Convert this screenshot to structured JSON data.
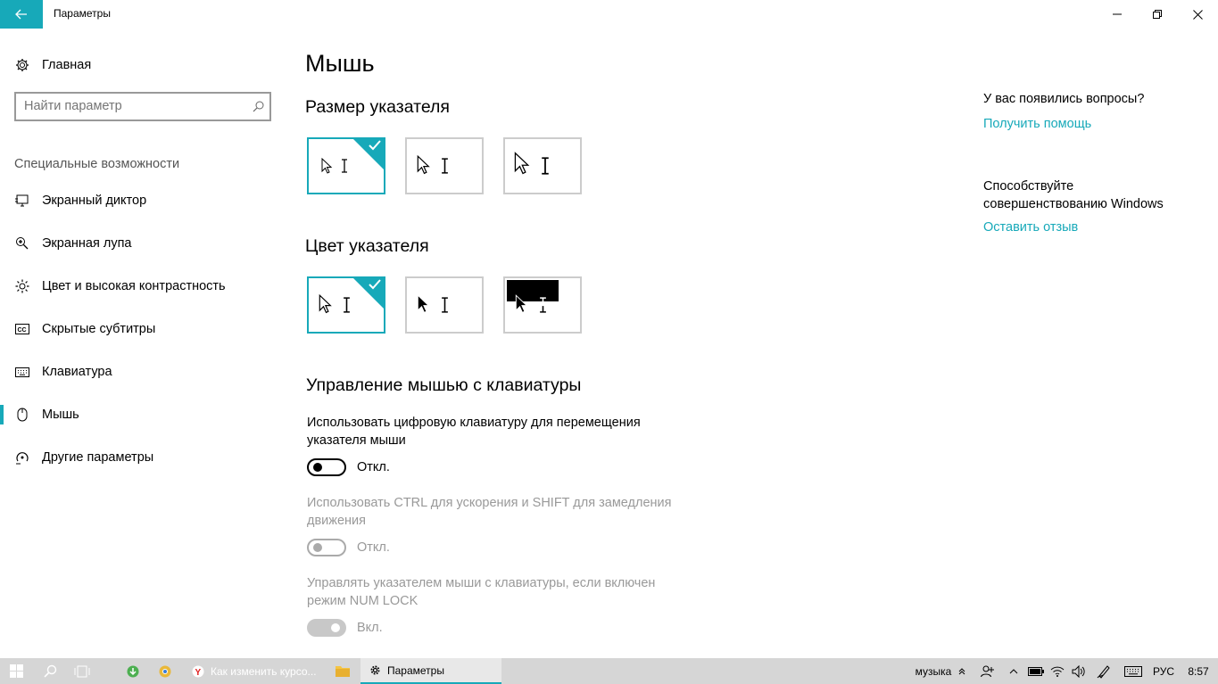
{
  "window": {
    "title": "Параметры",
    "icons": {
      "back": "back-arrow-icon",
      "minimize": "minimize-icon",
      "maximize": "restore-icon",
      "close": "close-icon"
    }
  },
  "sidebar": {
    "home_label": "Главная",
    "search_placeholder": "Найти параметр",
    "section_header": "Специальные возможности",
    "items": [
      {
        "label": "Экранный диктор",
        "icon": "narrator-icon"
      },
      {
        "label": "Экранная лупа",
        "icon": "magnifier-icon"
      },
      {
        "label": "Цвет и высокая контрастность",
        "icon": "brightness-icon"
      },
      {
        "label": "Скрытые субтитры",
        "icon": "closed-captions-icon"
      },
      {
        "label": "Клавиатура",
        "icon": "keyboard-icon"
      },
      {
        "label": "Мышь",
        "icon": "mouse-icon",
        "selected": true
      },
      {
        "label": "Другие параметры",
        "icon": "other-options-icon"
      }
    ]
  },
  "main": {
    "title": "Мышь",
    "pointer_size": {
      "heading": "Размер указателя",
      "selected_index": 0
    },
    "pointer_color": {
      "heading": "Цвет указателя",
      "selected_index": 0
    },
    "keys_heading": "Управление мышью с клавиатуры",
    "settings": [
      {
        "text": "Использовать цифровую клавиатуру для перемещения указателя мыши",
        "state_label": "Откл.",
        "on": false,
        "enabled": true
      },
      {
        "text": "Использовать CTRL для ускорения и SHIFT для замедления движения",
        "state_label": "Откл.",
        "on": false,
        "enabled": false
      },
      {
        "text": "Управлять указателем мыши с клавиатуры, если включен режим NUM LOCK",
        "state_label": "Вкл.",
        "on": true,
        "enabled": false
      }
    ]
  },
  "right": {
    "question": "У вас появились вопросы?",
    "help_link": "Получить помощь",
    "improve_text": "Способствуйте совершенствованию Windows",
    "feedback_link": "Оставить отзыв"
  },
  "taskbar": {
    "apps": [
      {
        "label": "Как изменить курсо...",
        "icon": "yandex-browser-icon"
      },
      {
        "label": "Параметры",
        "icon": "gear-icon",
        "active": true
      }
    ],
    "tray": {
      "toolbar_label": "музыка",
      "language": "РУС",
      "time": "8:57"
    }
  },
  "colors": {
    "accent": "#17a9b9",
    "taskbar": "#d6d6d6"
  }
}
